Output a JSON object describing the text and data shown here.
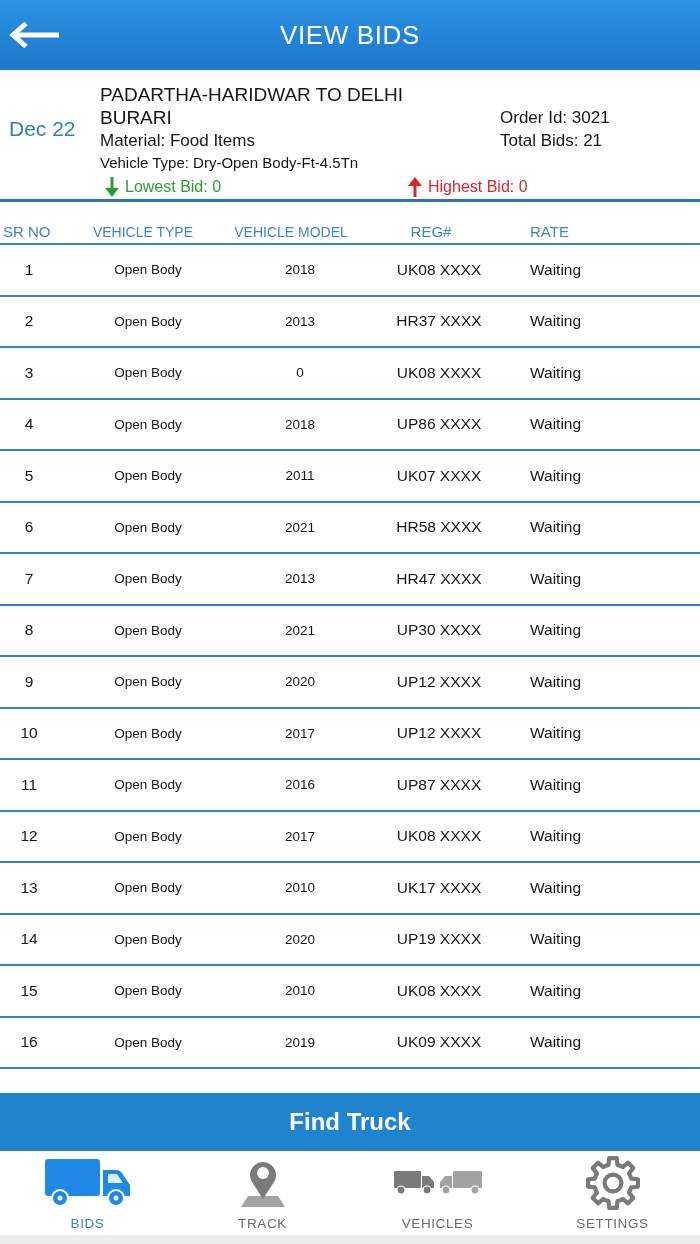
{
  "screen": {
    "title": "VIEW BIDS"
  },
  "order": {
    "date": "Dec 22",
    "route": "PADARTHA-HARIDWAR TO DELHI BURARI",
    "material": "Material: Food Items",
    "vehicle_type": "Vehicle Type: Dry-Open Body-Ft-4.5Tn",
    "order_id": "Order Id: 3021",
    "total_bids": "Total Bids: 21",
    "lowest_bid": "Lowest Bid: 0",
    "highest_bid": "Highest Bid: 0"
  },
  "table": {
    "columns": [
      "SR NO",
      "VEHICLE TYPE",
      "VEHICLE MODEL",
      "REG#",
      "RATE"
    ],
    "rows": [
      {
        "sr_no": "1",
        "vehicle_type": "Open Body",
        "vehicle_model": "2018",
        "reg": "UK08 XXXX",
        "rate": "Waiting"
      },
      {
        "sr_no": "2",
        "vehicle_type": "Open Body",
        "vehicle_model": "2013",
        "reg": "HR37 XXXX",
        "rate": "Waiting"
      },
      {
        "sr_no": "3",
        "vehicle_type": "Open Body",
        "vehicle_model": "0",
        "reg": "UK08 XXXX",
        "rate": "Waiting"
      },
      {
        "sr_no": "4",
        "vehicle_type": "Open Body",
        "vehicle_model": "2018",
        "reg": "UP86 XXXX",
        "rate": "Waiting"
      },
      {
        "sr_no": "5",
        "vehicle_type": "Open Body",
        "vehicle_model": "2011",
        "reg": "UK07 XXXX",
        "rate": "Waiting"
      },
      {
        "sr_no": "6",
        "vehicle_type": "Open Body",
        "vehicle_model": "2021",
        "reg": "HR58 XXXX",
        "rate": "Waiting"
      },
      {
        "sr_no": "7",
        "vehicle_type": "Open Body",
        "vehicle_model": "2013",
        "reg": "HR47 XXXX",
        "rate": "Waiting"
      },
      {
        "sr_no": "8",
        "vehicle_type": "Open Body",
        "vehicle_model": "2021",
        "reg": "UP30 XXXX",
        "rate": "Waiting"
      },
      {
        "sr_no": "9",
        "vehicle_type": "Open Body",
        "vehicle_model": "2020",
        "reg": "UP12 XXXX",
        "rate": "Waiting"
      },
      {
        "sr_no": "10",
        "vehicle_type": "Open Body",
        "vehicle_model": "2017",
        "reg": "UP12 XXXX",
        "rate": "Waiting"
      },
      {
        "sr_no": "11",
        "vehicle_type": "Open Body",
        "vehicle_model": "2016",
        "reg": "UP87 XXXX",
        "rate": "Waiting"
      },
      {
        "sr_no": "12",
        "vehicle_type": "Open Body",
        "vehicle_model": "2017",
        "reg": "UK08 XXXX",
        "rate": "Waiting"
      },
      {
        "sr_no": "13",
        "vehicle_type": "Open Body",
        "vehicle_model": "2010",
        "reg": "UK17 XXXX",
        "rate": "Waiting"
      },
      {
        "sr_no": "14",
        "vehicle_type": "Open Body",
        "vehicle_model": "2020",
        "reg": "UP19 XXXX",
        "rate": "Waiting"
      },
      {
        "sr_no": "15",
        "vehicle_type": "Open Body",
        "vehicle_model": "2010",
        "reg": "UK08 XXXX",
        "rate": "Waiting"
      },
      {
        "sr_no": "16",
        "vehicle_type": "Open Body",
        "vehicle_model": "2019",
        "reg": "UK09 XXXX",
        "rate": "Waiting"
      }
    ]
  },
  "action_button": {
    "label": "Find Truck"
  },
  "bottom_nav": [
    {
      "label": "BIDS",
      "selected": true
    },
    {
      "label": "TRACK",
      "selected": false
    },
    {
      "label": "VEHICLES",
      "selected": false
    },
    {
      "label": "SETTINGS",
      "selected": false
    }
  ]
}
